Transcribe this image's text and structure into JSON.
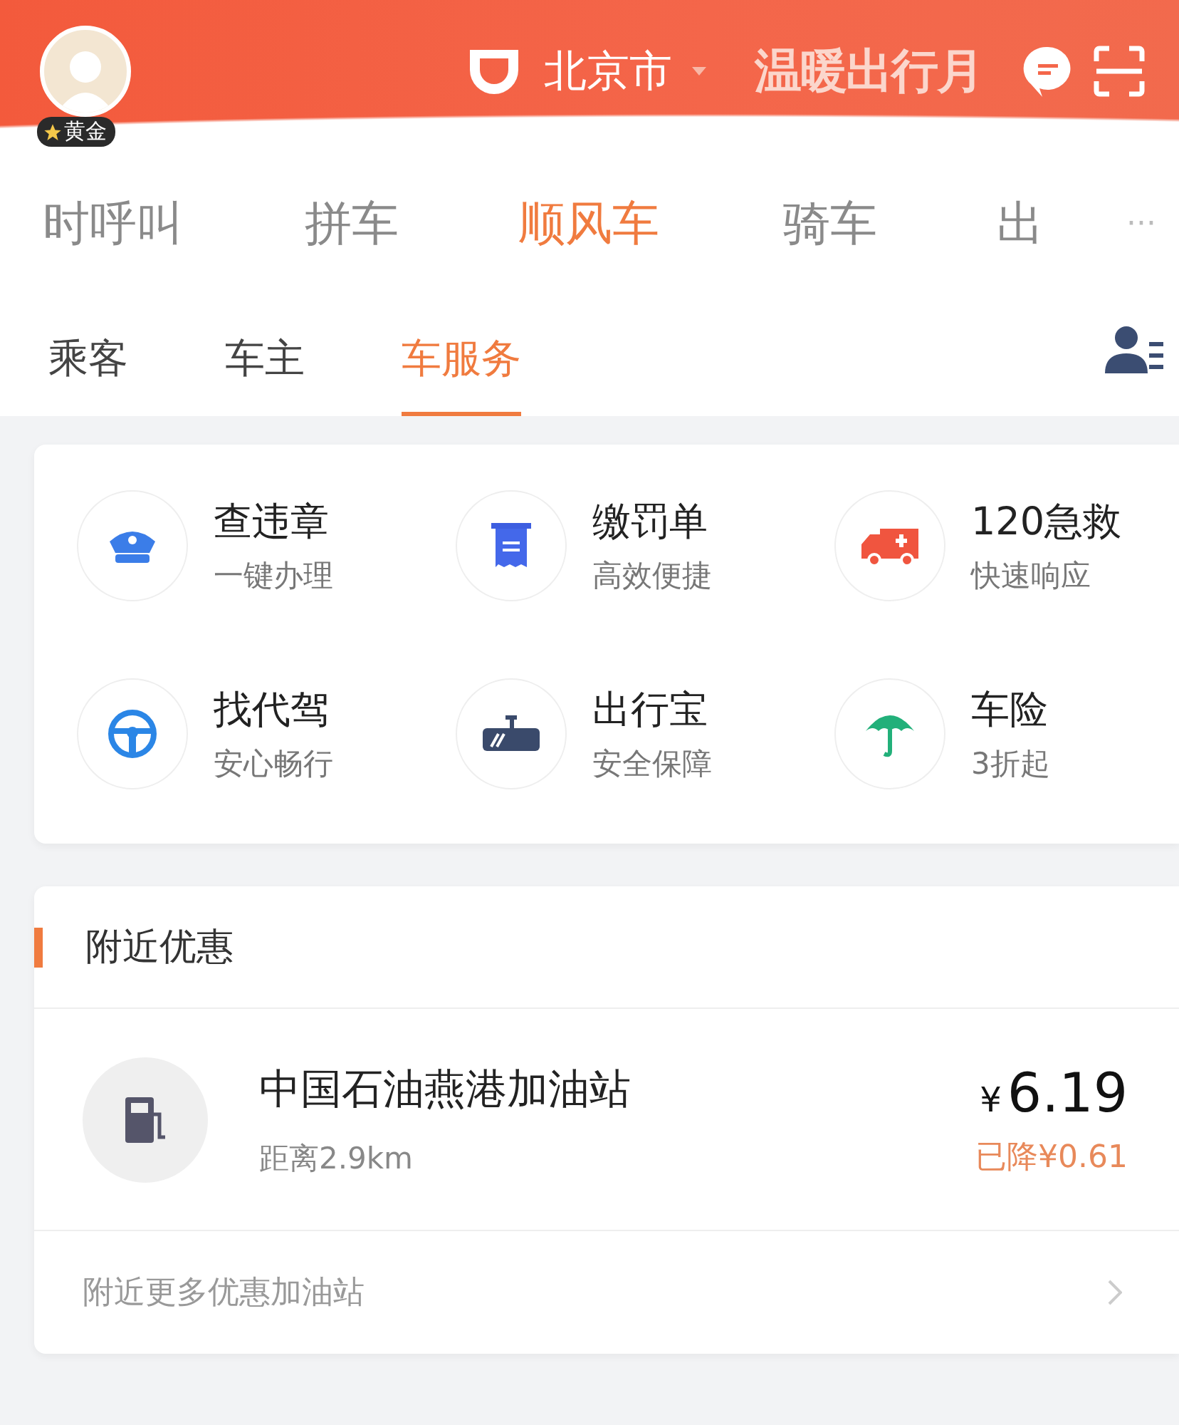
{
  "header": {
    "badge": "黄金",
    "city": "北京市",
    "slogan": "温暖出行月"
  },
  "nav": [
    {
      "label": "时呼叫",
      "selected": false
    },
    {
      "label": "拼车",
      "selected": false
    },
    {
      "label": "顺风车",
      "selected": true
    },
    {
      "label": "骑车",
      "selected": false
    },
    {
      "label": "出",
      "selected": false
    }
  ],
  "more": "···",
  "tabs": [
    {
      "label": "乘客",
      "selected": false
    },
    {
      "label": "车主",
      "selected": false
    },
    {
      "label": "车服务",
      "selected": true
    }
  ],
  "services": [
    {
      "title": "查违章",
      "subtitle": "一键办理"
    },
    {
      "title": "缴罚单",
      "subtitle": "高效便捷"
    },
    {
      "title": "120急救",
      "subtitle": "快速响应"
    },
    {
      "title": "找代驾",
      "subtitle": "安心畅行"
    },
    {
      "title": "出行宝",
      "subtitle": "安全保障"
    },
    {
      "title": "车险",
      "subtitle": "3折起"
    }
  ],
  "deals": {
    "title": "附近优惠",
    "station": {
      "name": "中国石油燕港加油站",
      "distance": "距离2.9km",
      "currency": "¥",
      "price": "6.19",
      "discount": "已降¥0.61"
    },
    "more": "附近更多优惠加油站"
  }
}
